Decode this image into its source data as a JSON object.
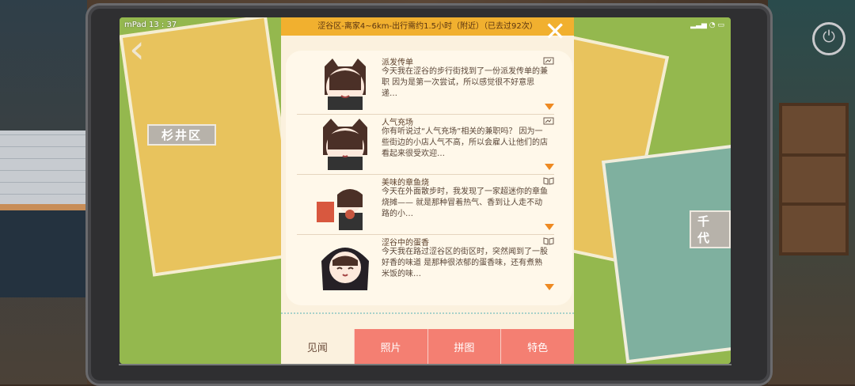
{
  "status": {
    "device": "mPad",
    "time": "13 : 37"
  },
  "map": {
    "left_district": "杉井区",
    "right_district": "千代"
  },
  "panel": {
    "header": "涩谷区-离家4~6km-出行需约1.5小时（附近）（已去过92次）",
    "close_icon": "close-icon",
    "items": [
      {
        "title": "派发传单",
        "text": "今天我在涩谷的步行街找到了一份派发传单的兼职 因为是第一次尝试，所以感觉很不好意思递…",
        "icon": "photo-icon"
      },
      {
        "title": "人气充场",
        "text": "你有听说过“人气充场”相关的兼职吗？ 因为一些街边的小店人气不高，所以会雇人让他们的店看起来很受欢迎…",
        "icon": "photo-icon"
      },
      {
        "title": "美味的章鱼烧",
        "text": "今天在外面散步时，我发现了一家超迷你的章鱼烧摊—— 就是那种冒着热气、香到让人走不动路的小…",
        "icon": "book-icon"
      },
      {
        "title": "涩谷中的蛋香",
        "text": "今天我在路过涩谷区的街区时，突然闻到了一股好香的味道 是那种很浓郁的蛋香味，还有煮熟米饭的味…",
        "icon": "book-icon"
      }
    ],
    "tabs": [
      "见闻",
      "照片",
      "拼图",
      "特色"
    ]
  }
}
